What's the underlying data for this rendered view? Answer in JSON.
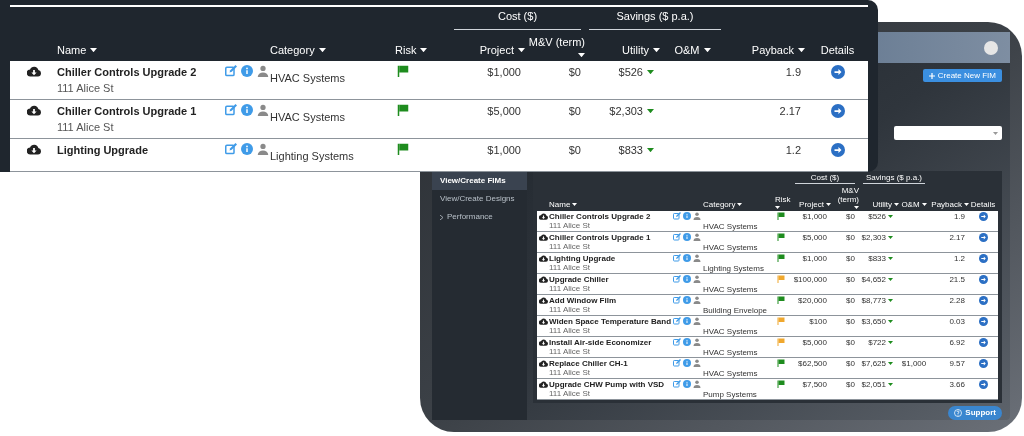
{
  "overlay_table": {
    "column_groups": [
      {
        "label": "Cost ($)"
      },
      {
        "label": "Savings ($ p.a.)"
      }
    ],
    "columns": [
      {
        "label": "Name",
        "sortable": true
      },
      {
        "label": "Category",
        "sortable": true
      },
      {
        "label": "Risk",
        "sortable": true
      },
      {
        "label": "Project",
        "sortable": true
      },
      {
        "label": "M&V (term)",
        "sortable": true
      },
      {
        "label": "Utility",
        "sortable": true
      },
      {
        "label": "O&M",
        "sortable": true
      },
      {
        "label": "Payback",
        "sortable": true
      },
      {
        "label": "Details",
        "sortable": false
      }
    ],
    "rows": [
      {
        "name": "Chiller Controls Upgrade 2",
        "address": "111 Alice St",
        "category": "HVAC Systems",
        "color": "#1e8c1e",
        "project": "$1,000",
        "mv": "$0",
        "utility": "$526",
        "payback": "1.9"
      },
      {
        "name": "Chiller Controls Upgrade 1",
        "address": "111 Alice St",
        "category": "HVAC Systems",
        "color": "#1e8c1e",
        "project": "$5,000",
        "mv": "$0",
        "utility": "$2,303",
        "payback": "2.17"
      },
      {
        "name": "Lighting Upgrade",
        "category": "Lighting Systems",
        "color": "#1e8c1e",
        "project": "$1,000",
        "mv": "$0",
        "utility": "$833",
        "payback": "1.2"
      }
    ]
  },
  "tablet": {
    "create_button": "Create New FIM",
    "sidebar": [
      {
        "label": "View/Create FIMs",
        "selected": true
      },
      {
        "label": "View/Create Designs",
        "selected": false
      },
      {
        "label": "Performance",
        "selected": false
      }
    ],
    "column_groups": [
      {
        "label": "Cost ($)"
      },
      {
        "label": "Savings ($ p.a.)"
      }
    ],
    "columns": [
      {
        "label": "Name",
        "sortable": true
      },
      {
        "label": "Category",
        "sortable": true
      },
      {
        "label": "Risk",
        "sortable": true
      },
      {
        "label": "Project",
        "sortable": true
      },
      {
        "label": "M&V (term)",
        "sortable": true
      },
      {
        "label": "Utility",
        "sortable": true
      },
      {
        "label": "O&M",
        "sortable": true
      },
      {
        "label": "Payback",
        "sortable": true
      },
      {
        "label": "Details",
        "sortable": false
      }
    ],
    "rows": [
      {
        "name": "Chiller Controls Upgrade 2",
        "address": "111 Alice St",
        "category": "HVAC Systems",
        "color": "#1e8c1e",
        "project": "$1,000",
        "mv": "$0",
        "utility": "$526",
        "payback": "1.9"
      },
      {
        "name": "Chiller Controls Upgrade 1",
        "address": "111 Alice St",
        "category": "HVAC Systems",
        "color": "#1e8c1e",
        "project": "$5,000",
        "mv": "$0",
        "utility": "$2,303",
        "payback": "2.17"
      },
      {
        "name": "Lighting Upgrade",
        "address": "111 Alice St",
        "category": "Lighting Systems",
        "color": "#1e8c1e",
        "project": "$1,000",
        "mv": "$0",
        "utility": "$833",
        "payback": "1.2"
      },
      {
        "name": "Upgrade Chiller",
        "address": "111 Alice St",
        "category": "HVAC Systems",
        "color": "#f0a82e",
        "project": "$100,000",
        "mv": "$0",
        "utility": "$4,652",
        "payback": "21.5"
      },
      {
        "name": "Add Window Film",
        "address": "111 Alice St",
        "category": "Building Envelope",
        "color": "#1e8c1e",
        "project": "$20,000",
        "mv": "$0",
        "utility": "$8,773",
        "payback": "2.28"
      },
      {
        "name": "Widen Space Temperature Band",
        "address": "111 Alice St",
        "category": "HVAC Systems",
        "color": "#f0a82e",
        "project": "$100",
        "mv": "$0",
        "utility": "$3,650",
        "payback": "0.03"
      },
      {
        "name": "Install Air-side Economizer",
        "address": "111 Alice St",
        "category": "HVAC Systems",
        "color": "#f0a82e",
        "project": "$5,000",
        "mv": "$0",
        "utility": "$722",
        "payback": "6.92"
      },
      {
        "name": "Replace Chiller CH-1",
        "address": "111 Alice St",
        "category": "HVAC Systems",
        "color": "#1e8c1e",
        "project": "$62,500",
        "mv": "$0",
        "utility": "$7,625",
        "om": "$1,000",
        "payback": "9.57"
      },
      {
        "name": "Upgrade CHW Pump with VSD",
        "address": "111 Alice St",
        "category": "Pump Systems",
        "color": "#1e8c1e",
        "project": "$7,500",
        "mv": "$0",
        "utility": "$2,051",
        "payback": "3.66"
      }
    ],
    "support_button": "Support"
  }
}
